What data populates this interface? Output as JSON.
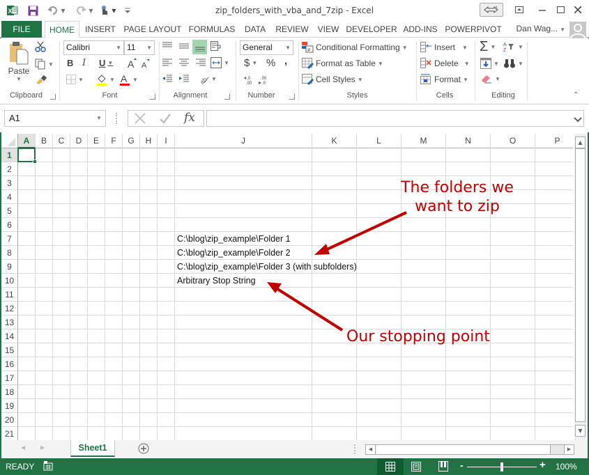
{
  "window": {
    "title": "zip_folders_with_vba_and_7zip - Excel",
    "help_icon": "help-display-options-icon",
    "controls": [
      "ribbon-display-options",
      "minimize",
      "maximize",
      "close"
    ]
  },
  "quick_access": {
    "app_icon": "excel-icon",
    "items": [
      "save",
      "undo",
      "redo",
      "touch-mode",
      "customize"
    ]
  },
  "tabs": [
    {
      "label": "FILE"
    },
    {
      "label": "HOME",
      "active": true
    },
    {
      "label": "INSERT"
    },
    {
      "label": "PAGE LAYOUT"
    },
    {
      "label": "FORMULAS"
    },
    {
      "label": "DATA"
    },
    {
      "label": "REVIEW"
    },
    {
      "label": "VIEW"
    },
    {
      "label": "DEVELOPER"
    },
    {
      "label": "ADD-INS"
    },
    {
      "label": "POWERPIVOT"
    }
  ],
  "user": {
    "name": "Dan Wag..."
  },
  "ribbon": {
    "clipboard": {
      "label": "Clipboard",
      "paste": "Paste"
    },
    "font": {
      "label": "Font",
      "font_name": "Calibri",
      "font_size": "11",
      "bold": "B",
      "italic": "I",
      "underline": "U"
    },
    "alignment": {
      "label": "Alignment"
    },
    "number": {
      "label": "Number",
      "format": "General",
      "currency": "$",
      "percent": "%",
      "comma": ",",
      "inc_decimal": ".00",
      "dec_decimal": ".0"
    },
    "styles": {
      "label": "Styles",
      "conditional": "Conditional Formatting",
      "format_table": "Format as Table",
      "cell_styles": "Cell Styles"
    },
    "cells": {
      "label": "Cells",
      "insert": "Insert",
      "delete": "Delete",
      "format": "Format"
    },
    "editing": {
      "label": "Editing",
      "sum": "Σ"
    }
  },
  "formula_bar": {
    "name_box": "A1",
    "fx": "fx",
    "value": ""
  },
  "sheet": {
    "columns": [
      "A",
      "B",
      "C",
      "D",
      "E",
      "F",
      "G",
      "H",
      "I",
      "J",
      "K",
      "L",
      "M",
      "N",
      "O",
      "P"
    ],
    "selected_column": "A",
    "rows": [
      "1",
      "2",
      "3",
      "4",
      "5",
      "6",
      "7",
      "8",
      "9",
      "10",
      "11",
      "12",
      "13",
      "14",
      "15",
      "16",
      "17",
      "18",
      "19",
      "20",
      "21"
    ],
    "selected_row": "1",
    "active_cell": "A1",
    "cells": [
      {
        "ref": "J7",
        "value": "C:\\blog\\zip_example\\Folder 1"
      },
      {
        "ref": "J8",
        "value": "C:\\blog\\zip_example\\Folder 2"
      },
      {
        "ref": "J9",
        "value": "C:\\blog\\zip_example\\Folder 3 (with subfolders)"
      },
      {
        "ref": "J10",
        "value": "Arbitrary Stop String"
      }
    ]
  },
  "annotations": [
    {
      "line1": "The folders we",
      "line2": "want to zip",
      "color": "#c00000"
    },
    {
      "line1": "Our stopping point",
      "color": "#c00000"
    }
  ],
  "sheet_tabs": [
    {
      "label": "Sheet1",
      "active": true
    }
  ],
  "status_bar": {
    "mode": "READY",
    "zoom": "100%",
    "zoom_level": 1.0
  },
  "colors": {
    "accent": "#217346",
    "annotation": "#c00000"
  }
}
